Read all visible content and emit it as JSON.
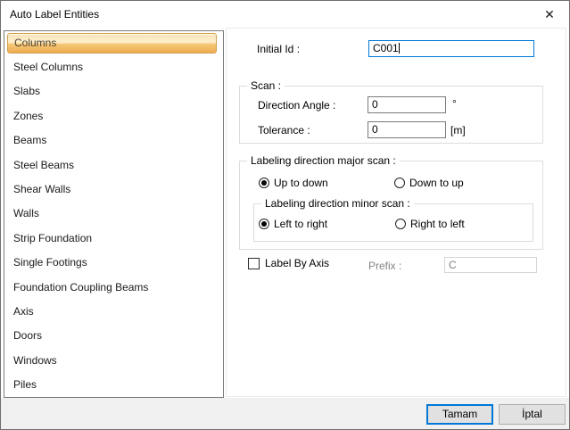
{
  "window": {
    "title": "Auto Label Entities",
    "close_icon": "✕"
  },
  "sidebar": {
    "items": [
      {
        "label": "Columns",
        "selected": true
      },
      {
        "label": "Steel Columns",
        "selected": false
      },
      {
        "label": "Slabs",
        "selected": false
      },
      {
        "label": "Zones",
        "selected": false
      },
      {
        "label": "Beams",
        "selected": false
      },
      {
        "label": "Steel Beams",
        "selected": false
      },
      {
        "label": "Shear Walls",
        "selected": false
      },
      {
        "label": "Walls",
        "selected": false
      },
      {
        "label": "Strip Foundation",
        "selected": false
      },
      {
        "label": "Single Footings",
        "selected": false
      },
      {
        "label": "Foundation Coupling Beams",
        "selected": false
      },
      {
        "label": "Axis",
        "selected": false
      },
      {
        "label": "Doors",
        "selected": false
      },
      {
        "label": "Windows",
        "selected": false
      },
      {
        "label": "Piles",
        "selected": false
      }
    ]
  },
  "form": {
    "initial_id": {
      "label": "Initial Id :",
      "value": "C001"
    },
    "scan": {
      "title": "Scan :",
      "rows": [
        {
          "label": "Direction Angle :",
          "value": "0",
          "unit": "°"
        },
        {
          "label": "Tolerance :",
          "value": "0",
          "unit": "[m]"
        }
      ]
    },
    "major_scan": {
      "title": "Labeling direction major scan :",
      "options": [
        {
          "label": "Up to down",
          "selected": true
        },
        {
          "label": "Down to up",
          "selected": false
        }
      ]
    },
    "minor_scan": {
      "title": "Labeling direction minor scan :",
      "options": [
        {
          "label": "Left to right",
          "selected": true
        },
        {
          "label": "Right to left",
          "selected": false
        }
      ]
    },
    "label_by_axis": {
      "label": "Label By Axis",
      "checked": false
    },
    "prefix": {
      "label": "Prefix :",
      "value": "C",
      "disabled": true
    }
  },
  "footer": {
    "ok_label": "Tamam",
    "cancel_label": "İptal"
  },
  "colors": {
    "selection_border": "#cfa050",
    "selection_gradient_top": "#fbe5bb",
    "selection_gradient_bottom": "#eeab51",
    "focus_border": "#0078d7",
    "footer_bg": "#f0f0f0",
    "disabled_text": "#838383"
  }
}
